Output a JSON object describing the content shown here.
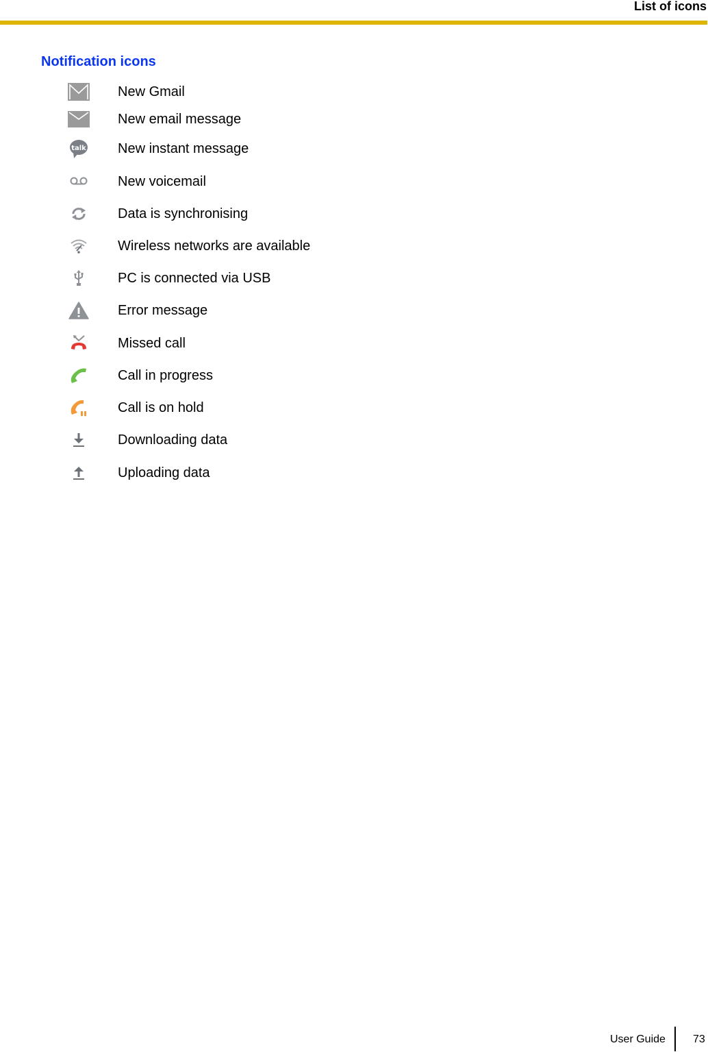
{
  "header": {
    "title": "List of icons",
    "rule_color": "#DDB400"
  },
  "section": {
    "title": "Notification icons",
    "title_color": "#0A36F0"
  },
  "icons": [
    {
      "icon": "gmail-icon",
      "label": "New Gmail"
    },
    {
      "icon": "email-icon",
      "label": "New email message"
    },
    {
      "icon": "talk-icon",
      "label": "New instant message"
    },
    {
      "icon": "voicemail-icon",
      "label": "New voicemail"
    },
    {
      "icon": "sync-icon",
      "label": "Data is synchronising"
    },
    {
      "icon": "wifi-icon",
      "label": "Wireless networks are available"
    },
    {
      "icon": "usb-icon",
      "label": "PC is connected via USB"
    },
    {
      "icon": "warning-icon",
      "label": "Error message"
    },
    {
      "icon": "missed-call-icon",
      "label": "Missed call"
    },
    {
      "icon": "call-in-progress-icon",
      "label": "Call in progress"
    },
    {
      "icon": "call-on-hold-icon",
      "label": "Call is on hold"
    },
    {
      "icon": "download-icon",
      "label": "Downloading data"
    },
    {
      "icon": "upload-icon",
      "label": "Uploading data"
    }
  ],
  "colors": {
    "icon_gray": "#8E9196",
    "missed_call_red": "#E53935",
    "call_green": "#6CC04A",
    "hold_orange": "#F39A3A"
  },
  "footer": {
    "label": "User Guide",
    "page_number": "73"
  }
}
